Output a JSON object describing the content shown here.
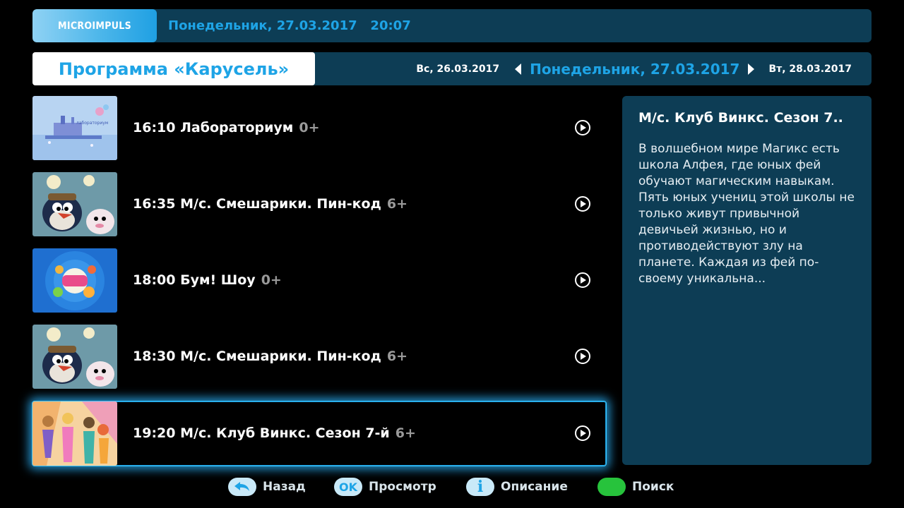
{
  "header": {
    "logo_text": "MICROIMPULS",
    "datetime": "Понедельник, 27.03.2017   20:07"
  },
  "date_bar": {
    "channel_title": "Программа «Карусель»",
    "prev_date": "Вс, 26.03.2017",
    "current_date": "Понедельник, 27.03.2017",
    "next_date": "Вт, 28.03.2017"
  },
  "programs": [
    {
      "time": "16:10",
      "title": "Лабораториум",
      "age": "0+",
      "selected": false,
      "thumb": "laboratorium"
    },
    {
      "time": "16:35",
      "title": "М/с. Смешарики. Пин-код",
      "age": "6+",
      "selected": false,
      "thumb": "smeshariki"
    },
    {
      "time": "18:00",
      "title": "Бум! Шоу",
      "age": "0+",
      "selected": false,
      "thumb": "bum-show"
    },
    {
      "time": "18:30",
      "title": "М/с. Смешарики. Пин-код",
      "age": "6+",
      "selected": false,
      "thumb": "smeshariki"
    },
    {
      "time": "19:20",
      "title": "М/с. Клуб Винкс. Сезон 7-й",
      "age": "6+",
      "selected": true,
      "thumb": "winx"
    }
  ],
  "program_rows_text": [
    "16:10 Лабораториум",
    "16:35 М/с. Смешарики. Пин-код",
    "18:00 Бум! Шоу",
    "18:30 М/с. Смешарики. Пин-код",
    "19:20 М/с. Клуб Винкс. Сезон 7-й"
  ],
  "description": {
    "title": "М/с. Клуб Винкс. Сезон 7..",
    "text": "В волшебном мире Магикс есть школа Алфея, где юных фей обучают магическим навыкам. Пять юных учениц этой школы не только живут привычной девичьей жизнью, но и противодействуют злу на планете. Каждая из фей по-своему уникальна..."
  },
  "help_bar": {
    "back_label": "Назад",
    "ok_key": "OK",
    "ok_label": "Просмотр",
    "info_key": "i",
    "info_label": "Описание",
    "search_label": "Поиск"
  },
  "colors": {
    "accent": "#1ea4e6",
    "panel": "#0d3d55",
    "selection_glow": "#3ac6ff",
    "green_key": "#27c33c"
  },
  "icons": {
    "play": "play-circle-icon",
    "back": "back-arrow-icon",
    "info": "info-icon",
    "date_prev": "chevron-left-icon",
    "date_next": "chevron-right-icon"
  }
}
